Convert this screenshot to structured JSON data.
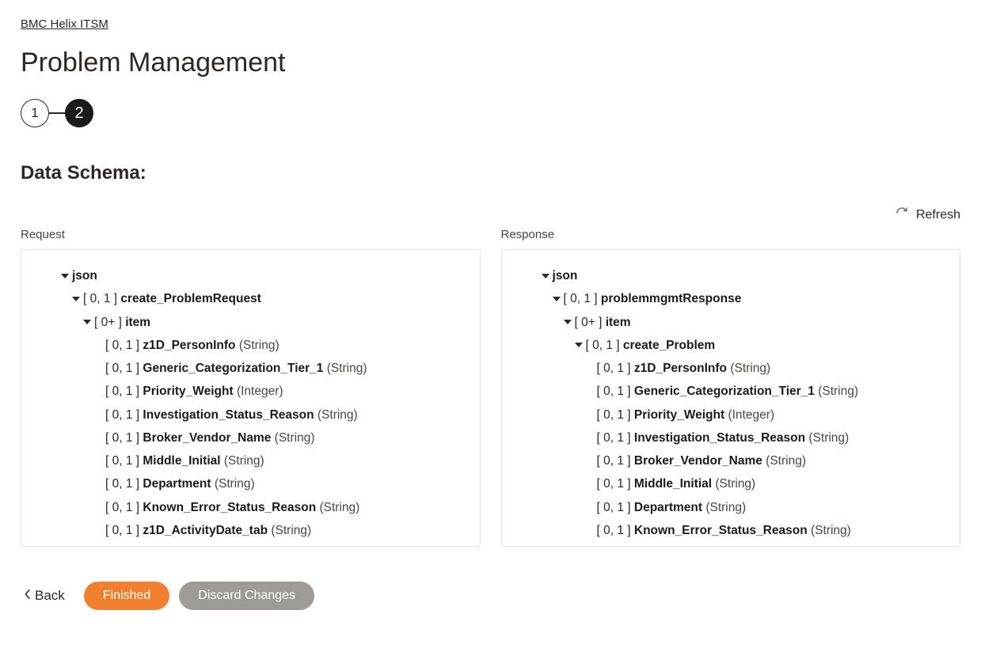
{
  "breadcrumb": {
    "label": "BMC Helix ITSM"
  },
  "page_title": "Problem Management",
  "stepper": {
    "step1": "1",
    "step2": "2",
    "active": 2
  },
  "section_title": "Data Schema:",
  "refresh": {
    "label": "Refresh"
  },
  "columns": {
    "request_label": "Request",
    "response_label": "Response"
  },
  "request_tree": [
    {
      "indent": 0,
      "caret": true,
      "text_parts": [
        "",
        "json",
        ""
      ]
    },
    {
      "indent": 1,
      "caret": true,
      "text_parts": [
        "[ 0, 1 ] ",
        "create_ProblemRequest",
        ""
      ]
    },
    {
      "indent": 2,
      "caret": true,
      "text_parts": [
        "[ 0+ ] ",
        "item",
        ""
      ]
    },
    {
      "indent": 3,
      "caret": false,
      "text_parts": [
        "[ 0, 1 ] ",
        "z1D_PersonInfo",
        " (String)"
      ]
    },
    {
      "indent": 3,
      "caret": false,
      "text_parts": [
        "[ 0, 1 ] ",
        "Generic_Categorization_Tier_1",
        " (String)"
      ]
    },
    {
      "indent": 3,
      "caret": false,
      "text_parts": [
        "[ 0, 1 ] ",
        "Priority_Weight",
        " (Integer)"
      ]
    },
    {
      "indent": 3,
      "caret": false,
      "text_parts": [
        "[ 0, 1 ] ",
        "Investigation_Status_Reason",
        " (String)"
      ]
    },
    {
      "indent": 3,
      "caret": false,
      "text_parts": [
        "[ 0, 1 ] ",
        "Broker_Vendor_Name",
        " (String)"
      ]
    },
    {
      "indent": 3,
      "caret": false,
      "text_parts": [
        "[ 0, 1 ] ",
        "Middle_Initial",
        " (String)"
      ]
    },
    {
      "indent": 3,
      "caret": false,
      "text_parts": [
        "[ 0, 1 ] ",
        "Department",
        " (String)"
      ]
    },
    {
      "indent": 3,
      "caret": false,
      "text_parts": [
        "[ 0, 1 ] ",
        "Known_Error_Status_Reason",
        " (String)"
      ]
    },
    {
      "indent": 3,
      "caret": false,
      "text_parts": [
        "[ 0, 1 ] ",
        "z1D_ActivityDate_tab",
        " (String)"
      ]
    }
  ],
  "response_tree": [
    {
      "indent": 0,
      "caret": true,
      "text_parts": [
        "",
        "json",
        ""
      ]
    },
    {
      "indent": 1,
      "caret": true,
      "text_parts": [
        "[ 0, 1 ] ",
        "problemmgmtResponse",
        ""
      ]
    },
    {
      "indent": 2,
      "caret": true,
      "text_parts": [
        "[ 0+ ] ",
        "item",
        ""
      ]
    },
    {
      "indent": 3,
      "caret": true,
      "text_parts": [
        "[ 0, 1 ] ",
        "create_Problem",
        ""
      ]
    },
    {
      "indent": 4,
      "caret": false,
      "text_parts": [
        "[ 0, 1 ] ",
        "z1D_PersonInfo",
        " (String)"
      ]
    },
    {
      "indent": 4,
      "caret": false,
      "text_parts": [
        "[ 0, 1 ] ",
        "Generic_Categorization_Tier_1",
        " (String)"
      ]
    },
    {
      "indent": 4,
      "caret": false,
      "text_parts": [
        "[ 0, 1 ] ",
        "Priority_Weight",
        " (Integer)"
      ]
    },
    {
      "indent": 4,
      "caret": false,
      "text_parts": [
        "[ 0, 1 ] ",
        "Investigation_Status_Reason",
        " (String)"
      ]
    },
    {
      "indent": 4,
      "caret": false,
      "text_parts": [
        "[ 0, 1 ] ",
        "Broker_Vendor_Name",
        " (String)"
      ]
    },
    {
      "indent": 4,
      "caret": false,
      "text_parts": [
        "[ 0, 1 ] ",
        "Middle_Initial",
        " (String)"
      ]
    },
    {
      "indent": 4,
      "caret": false,
      "text_parts": [
        "[ 0, 1 ] ",
        "Department",
        " (String)"
      ]
    },
    {
      "indent": 4,
      "caret": false,
      "text_parts": [
        "[ 0, 1 ] ",
        "Known_Error_Status_Reason",
        " (String)"
      ]
    }
  ],
  "footer": {
    "back": "Back",
    "finished": "Finished",
    "discard": "Discard Changes"
  },
  "colors": {
    "accent": "#f08030"
  }
}
